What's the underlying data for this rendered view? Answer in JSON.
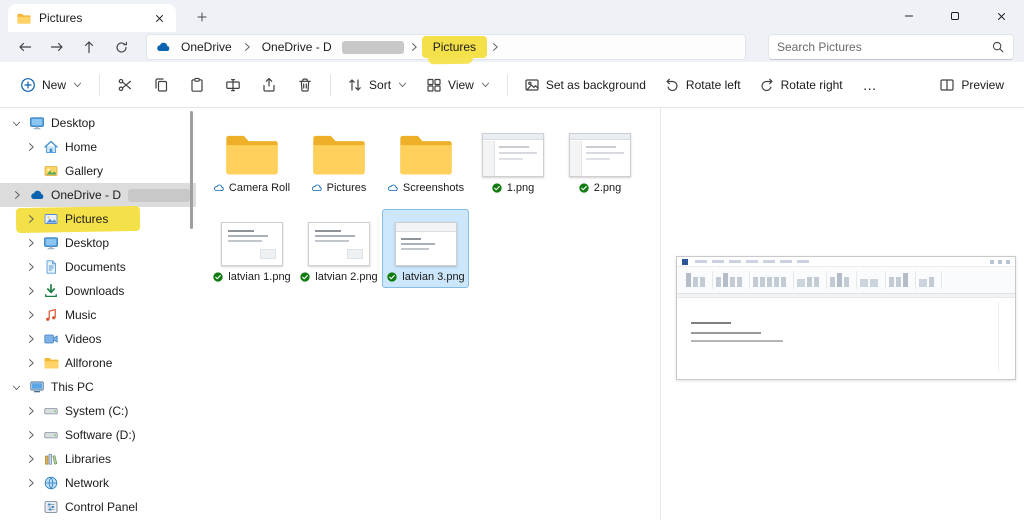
{
  "window": {
    "tab": {
      "title": "Pictures"
    }
  },
  "navigation": {
    "breadcrumb": {
      "root_label": "OneDrive",
      "drive_label": "OneDrive - D",
      "current_label": "Pictures"
    },
    "search": {
      "placeholder": "Search Pictures"
    }
  },
  "toolbar": {
    "new": "New",
    "sort": "Sort",
    "view": "View",
    "set_as_background": "Set as background",
    "rotate_left": "Rotate left",
    "rotate_right": "Rotate right",
    "more": "…",
    "preview": "Preview"
  },
  "sidebar": {
    "items": [
      {
        "label": "Desktop",
        "icon": "monitor-icon",
        "chevron": "down",
        "level": 0
      },
      {
        "label": "Home",
        "icon": "home-icon",
        "chevron": "right",
        "level": 1
      },
      {
        "label": "Gallery",
        "icon": "gallery-icon",
        "chevron": "none",
        "level": 1
      },
      {
        "label": "OneDrive - D",
        "icon": "onedrive-icon",
        "chevron": "right",
        "level": 0,
        "selected": true,
        "redacted": true
      },
      {
        "label": "Pictures",
        "icon": "pictures-icon",
        "chevron": "right",
        "level": 1,
        "highlighted": true
      },
      {
        "label": "Desktop",
        "icon": "monitor-icon",
        "chevron": "right",
        "level": 1
      },
      {
        "label": "Documents",
        "icon": "document-icon",
        "chevron": "right",
        "level": 1
      },
      {
        "label": "Downloads",
        "icon": "download-icon",
        "chevron": "right",
        "level": 1
      },
      {
        "label": "Music",
        "icon": "music-icon",
        "chevron": "right",
        "level": 1
      },
      {
        "label": "Videos",
        "icon": "video-icon",
        "chevron": "right",
        "level": 1
      },
      {
        "label": "Allforone",
        "icon": "folder-icon",
        "chevron": "right",
        "level": 1
      },
      {
        "label": "This PC",
        "icon": "pc-icon",
        "chevron": "down",
        "level": 0
      },
      {
        "label": "System (C:)",
        "icon": "drive-icon",
        "chevron": "right",
        "level": 1
      },
      {
        "label": "Software (D:)",
        "icon": "drive-icon",
        "chevron": "right",
        "level": 1
      },
      {
        "label": "Libraries",
        "icon": "libraries-icon",
        "chevron": "right",
        "level": 1
      },
      {
        "label": "Network",
        "icon": "network-icon",
        "chevron": "right",
        "level": 1
      },
      {
        "label": "Control Panel",
        "icon": "control-panel-icon",
        "chevron": "none",
        "level": 1
      }
    ]
  },
  "files": {
    "items": [
      {
        "name": "Camera Roll",
        "type": "folder",
        "status": "cloud"
      },
      {
        "name": "Pictures",
        "type": "folder",
        "status": "cloud"
      },
      {
        "name": "Screenshots",
        "type": "folder",
        "status": "cloud"
      },
      {
        "name": "1.png",
        "type": "image",
        "status": "synced",
        "thumb": "explorer"
      },
      {
        "name": "2.png",
        "type": "image",
        "status": "synced",
        "thumb": "explorer"
      },
      {
        "name": "latvian 1.png",
        "type": "image",
        "status": "synced",
        "thumb": "doc"
      },
      {
        "name": "latvian 2.png",
        "type": "image",
        "status": "synced",
        "thumb": "doc"
      },
      {
        "name": "latvian 3.png",
        "type": "image",
        "status": "synced",
        "thumb": "word",
        "selected": true
      }
    ]
  },
  "colors": {
    "highlight_yellow": "#f4e14a",
    "selection_blue": "#cce6fb",
    "accent_blue": "#0b63b0",
    "synced_green": "#0f7b0f"
  }
}
